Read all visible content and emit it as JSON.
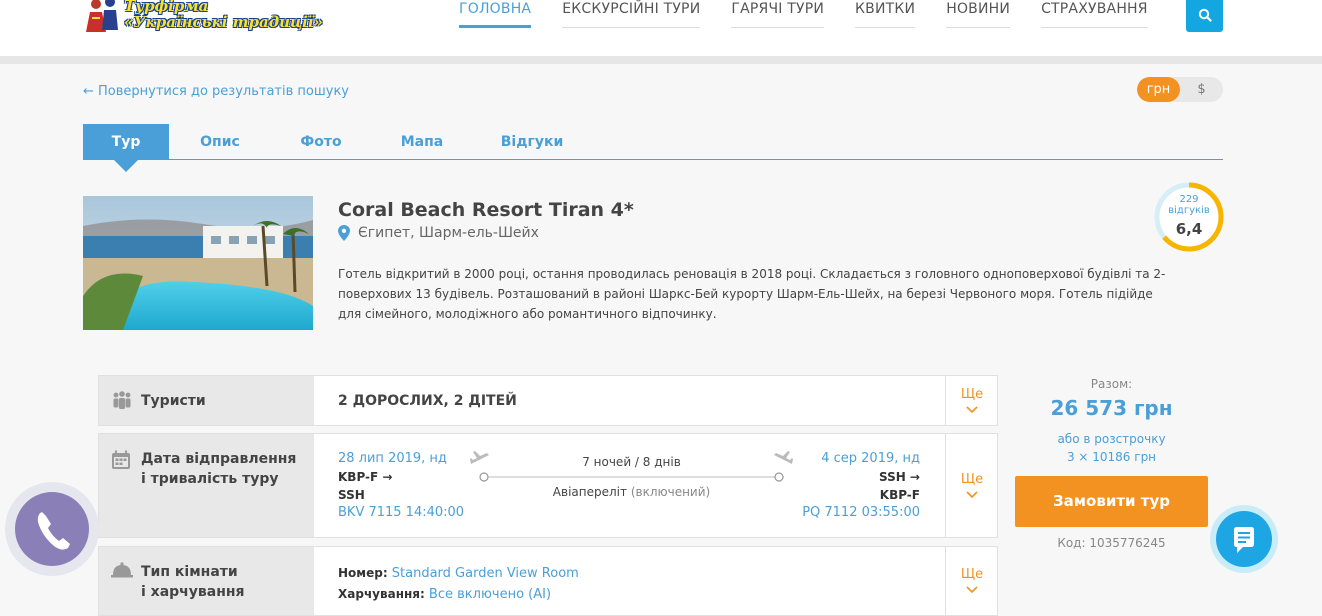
{
  "header": {
    "logo_text_line1": "Турфірма",
    "logo_text_line2": "«Українські традиції»",
    "nav": [
      {
        "label": "ГОЛОВНА",
        "active": true
      },
      {
        "label": "ЕКСКУРСІЙНІ ТУРИ",
        "active": false
      },
      {
        "label": "ГАРЯЧІ ТУРИ",
        "active": false
      },
      {
        "label": "КВИТКИ",
        "active": false
      },
      {
        "label": "НОВИНИ",
        "active": false
      },
      {
        "label": "СТРАХУВАННЯ",
        "active": false
      }
    ]
  },
  "back_link": "← Повернутися до результатів пошуку",
  "currency": {
    "options": [
      "грн",
      "$"
    ],
    "selected": "грн"
  },
  "tabs": [
    "Тур",
    "Опис",
    "Фото",
    "Мапа",
    "Відгуки"
  ],
  "hotel": {
    "name": "Coral Beach Resort Tiran 4*",
    "location": "Єгипет, Шарм-ель-Шейх",
    "description": "Готель відкритий в 2000 році, остання проводилась реновація в 2018 році. Складається з головного одноповерхової будівлі та 2-поверхових 13 будівель. Розташований в районі Шаркс-Бей курорту Шарм-Ель-Шейх, на березі Червоного моря. Готель підійде для сімейного, молодіжного або романтичного відпочинку.",
    "reviews_count": "229",
    "reviews_label": "відгуків",
    "rating": "6,4",
    "rating_fraction": 0.64
  },
  "rows": {
    "more_label": "Ще",
    "tourists": {
      "label": "Туристи",
      "value": "2 ДОРОСЛИХ, 2 ДІТЕЙ"
    },
    "departure": {
      "label_line1": "Дата відправлення",
      "label_line2": "і тривалість туру",
      "out_date": "28 лип 2019, нд",
      "out_route_from": "KBP-F →",
      "out_route_to": "SSH",
      "out_flight": "BKV 7115 14:40:00",
      "duration": "7 ночей / 8 днів",
      "flight_type": "Авіапереліт",
      "flight_included": "(включений)",
      "back_date": "4 сер 2019, нд",
      "back_route_from": "SSH →",
      "back_route_to": "KBP-F",
      "back_flight": "PQ 7112 03:55:00"
    },
    "room": {
      "label_line1": "Тип кімнати",
      "label_line2": "і харчування",
      "room_label": "Номер:",
      "room_value": "Standard Garden View Room",
      "meal_label": "Харчування:",
      "meal_value": "Все включено (AI)"
    }
  },
  "summary": {
    "total_label": "Разом:",
    "total_value": "26 573 грн",
    "installment_label": "або в розстрочку",
    "installment_value": "3 × 10186 грн",
    "order_button": "Замовити тур",
    "code": "Код: 1035776245"
  },
  "colors": {
    "accent": "#4a9fd8",
    "orange": "#f39221",
    "search": "#14a6e0",
    "phone": "#8b7fb8",
    "chat": "#1ea6e4"
  }
}
